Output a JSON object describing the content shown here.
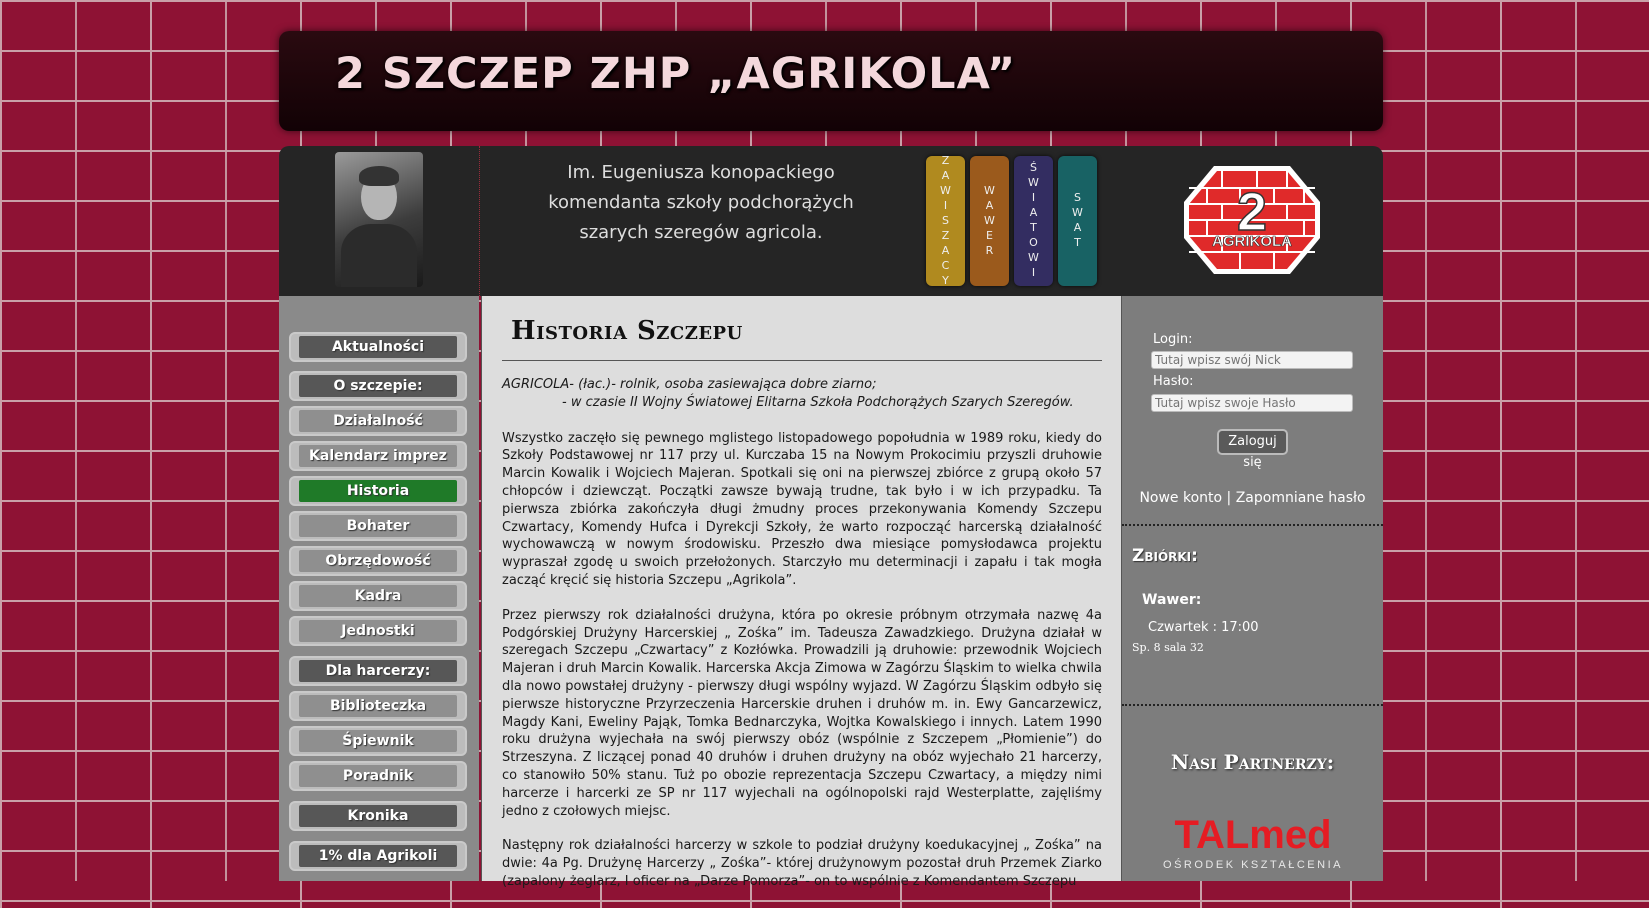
{
  "header": {
    "title": "2 SZCZEP ZHP „AGRIKOLA”"
  },
  "banner": {
    "patron_lines": [
      "Im. Eugeniusza konopackiego",
      "komendanta szkoły podchorążych",
      "szarych szeregów agricola."
    ],
    "teams": [
      {
        "label": "ZAWISZACY",
        "color": "#b08a1f"
      },
      {
        "label": "WAWER",
        "color": "#9b5a1c"
      },
      {
        "label": "ŚWIATOWI",
        "color": "#332d61"
      },
      {
        "label": "SWAT",
        "color": "#186264"
      }
    ],
    "logo": {
      "number": "2",
      "text": "AGRIKOLA",
      "color": "#e02a2a"
    }
  },
  "menu": {
    "items": [
      {
        "label": "Aktualności",
        "type": "section"
      },
      {
        "label": "O szczepie:",
        "type": "section"
      },
      {
        "label": "Działalność",
        "type": "link"
      },
      {
        "label": "Kalendarz imprez",
        "type": "link"
      },
      {
        "label": "Historia",
        "type": "active"
      },
      {
        "label": "Bohater",
        "type": "link"
      },
      {
        "label": "Obrzędowość",
        "type": "link"
      },
      {
        "label": "Kadra",
        "type": "link"
      },
      {
        "label": "Jednostki",
        "type": "link"
      },
      {
        "label": "Dla harcerzy:",
        "type": "section"
      },
      {
        "label": "Biblioteczka",
        "type": "link"
      },
      {
        "label": "Śpiewnik",
        "type": "link"
      },
      {
        "label": "Poradnik",
        "type": "link"
      },
      {
        "label": "Kronika",
        "type": "section"
      },
      {
        "label": "1% dla Agrikoli",
        "type": "section"
      }
    ]
  },
  "article": {
    "title": "Historia Szczepu",
    "definition_1": "AGRICOLA- (łac.)- rolnik, osoba zasiewająca dobre ziarno;",
    "definition_2": "- w czasie II Wojny Światowej Elitarna Szkoła Podchorążych Szarych Szeregów.",
    "paragraph_1": "Wszystko zaczęło się pewnego mglistego listopadowego popołudnia w 1989 roku, kiedy do Szkoły Podstawowej nr 117 przy ul. Kurczaba 15 na Nowym Prokocimiu przyszli druhowie Marcin Kowalik i Wojciech Majeran. Spotkali się oni na pierwszej zbiórce z grupą około 57 chłopców i dziewcząt. Początki zawsze bywają trudne, tak było i w ich przypadku. Ta pierwsza zbiórka zakończyła długi żmudny proces przekonywania Komendy Szczepu Czwartacy, Komendy Hufca i Dyrekcji Szkoły, że warto rozpocząć harcerską działalność wychowawczą w nowym środowisku. Przeszło dwa miesiące pomysłodawca projektu wypraszał zgodę u swoich przełożonych. Starczyło mu determinacji i zapału i tak mogła zacząć kręcić się historia Szczepu „Agrikola”.",
    "paragraph_2": "Przez pierwszy rok działalności drużyna, która po okresie próbnym otrzymała nazwę 4a Podgórskiej Drużyny Harcerskiej „ Zośka” im. Tadeusza Zawadzkiego. Drużyna działał w szeregach Szczepu „Czwartacy” z Kozłówka. Prowadzili ją druhowie: przewodnik Wojciech Majeran i druh Marcin Kowalik.  Harcerska Akcja Zimowa w Zagórzu Śląskim to wielka chwila dla nowo powstałej drużyny - pierwszy długi wspólny wyjazd. W Zagórzu Śląskim odbyło się pierwsze historyczne Przyrzeczenia Harcerskie druhen i druhów m. in. Ewy Gancarzewicz, Magdy Kani, Eweliny Pająk, Tomka Bednarczyka, Wojtka Kowalskiego i innych. Latem 1990 roku drużyna wyjechała na swój pierwszy obóz (wspólnie z Szczepem „Płomienie”) do Strzeszyna. Z liczącej ponad 40 druhów i druhen drużyny na obóz wyjechało 21 harcerzy, co stanowiło 50% stanu. Tuż po obozie reprezentacja Szczepu Czwartacy, a między nimi harcerze i harcerki ze SP nr 117 wyjechali na ogólnopolski rajd Westerplatte, zajęliśmy jedno z czołowych miejsc.",
    "paragraph_3": "Następny rok działalności harcerzy w szkole to podział drużyny koedukacyjnej „ Zośka” na dwie: 4a Pg. Drużynę Harcerzy „ Zośka”- której drużynowym pozostał druh Przemek Ziarko (zapalony żeglarz, I oficer na „Darze Pomorza”- on to wspólnie z Komendantem Szczepu"
  },
  "login": {
    "login_label": "Login:",
    "login_placeholder": "Tutaj wpisz swój Nick",
    "password_label": "Hasło:",
    "password_placeholder": "Tutaj wpisz swoje Hasło",
    "submit_label": "Zaloguj się",
    "new_account": "Nowe konto",
    "separator": "|",
    "forgot_password": "Zapomniane hasło"
  },
  "meetings": {
    "title": "Zbiórki:",
    "team": "Wawer:",
    "time": "Czwartek : 17:00",
    "place": "Sp. 8 sala 32"
  },
  "partners": {
    "title": "Nasi Partnerzy:",
    "partner_name": "TALmed",
    "partner_subtitle": "OŚRODEK KSZTAŁCENIA"
  }
}
